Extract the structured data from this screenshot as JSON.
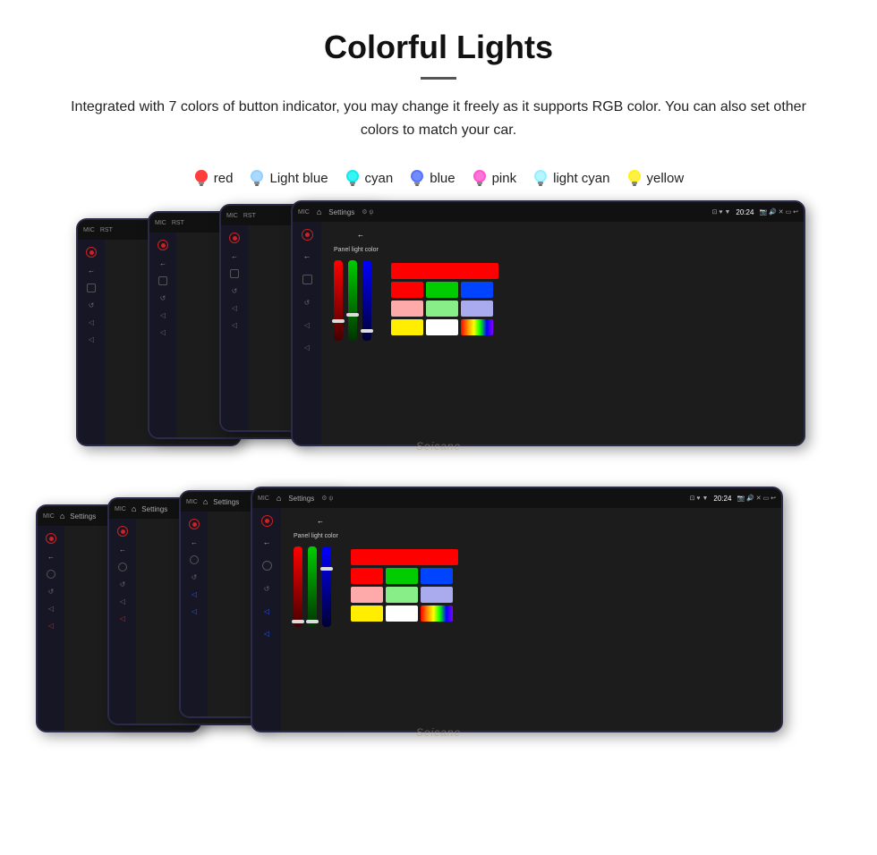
{
  "page": {
    "title": "Colorful Lights",
    "description": "Integrated with 7 colors of button indicator, you may change it freely as it supports RGB color. You can also set other colors to match your car.",
    "divider": "—"
  },
  "colors": [
    {
      "name": "red",
      "color": "#ff2020",
      "glow": "#ff6666"
    },
    {
      "name": "Light blue",
      "color": "#88ccff",
      "glow": "#aaddff"
    },
    {
      "name": "cyan",
      "color": "#00e5e5",
      "glow": "#44ffff"
    },
    {
      "name": "blue",
      "color": "#4488ff",
      "glow": "#88aaff"
    },
    {
      "name": "pink",
      "color": "#ff44cc",
      "glow": "#ff88dd"
    },
    {
      "name": "light cyan",
      "color": "#88eeff",
      "glow": "#aaf0ff"
    },
    {
      "name": "yellow",
      "color": "#ffee44",
      "glow": "#ffee88"
    }
  ],
  "topbar": {
    "settings_label": "Settings",
    "time": "20:24"
  },
  "watermark": "Seicane",
  "panel_label": "Panel light color",
  "color_grid_top": [
    [
      "#ff0000",
      "#00cc00",
      "#0000ff"
    ],
    [
      "#ff0000",
      "#00cc00",
      "#0000ff"
    ],
    [
      "#ffaaaa",
      "#88ee88",
      "#aaaaff"
    ],
    [
      "#ffee00",
      "#ffffff",
      "rainbow"
    ]
  ]
}
